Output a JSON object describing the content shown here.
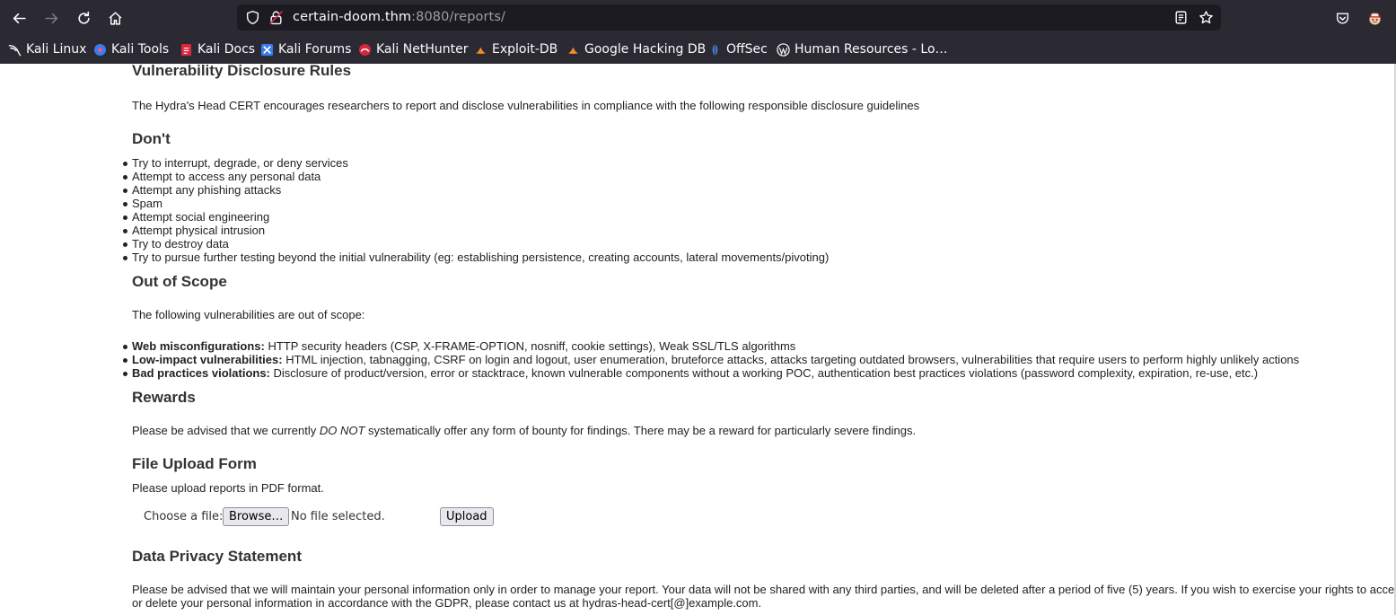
{
  "browser": {
    "url_host": "certain-doom.thm",
    "url_path": ":8080/reports/",
    "bookmarks": [
      {
        "label": "Kali Linux",
        "icon": "kali-dragon-icon"
      },
      {
        "label": "Kali Tools",
        "icon": "kali-tools-icon"
      },
      {
        "label": "Kali Docs",
        "icon": "kali-docs-icon"
      },
      {
        "label": "Kali Forums",
        "icon": "kali-forums-icon"
      },
      {
        "label": "Kali NetHunter",
        "icon": "kali-nethunter-icon"
      },
      {
        "label": "Exploit-DB",
        "icon": "exploit-db-icon"
      },
      {
        "label": "Google Hacking DB",
        "icon": "ghdb-icon"
      },
      {
        "label": "OffSec",
        "icon": "offsec-icon"
      },
      {
        "label": "Human Resources - Lo…",
        "icon": "wordpress-icon"
      }
    ]
  },
  "page": {
    "title": "Vulnerability Disclosure Rules",
    "intro": "The Hydra's Head CERT encourages researchers to report and disclose vulnerabilities in compliance with the following responsible disclosure guidelines",
    "dont": {
      "heading": "Don't",
      "items": [
        "Try to interrupt, degrade, or deny services",
        "Attempt to access any personal data",
        "Attempt any phishing attacks",
        "Spam",
        "Attempt social engineering",
        "Attempt physical intrusion",
        "Try to destroy data",
        "Try to pursue further testing beyond the initial vulnerability (eg: establishing persistence, creating accounts, lateral movements/pivoting)"
      ]
    },
    "scope": {
      "heading": "Out of Scope",
      "intro": "The following vulnerabilities are out of scope:",
      "items": [
        {
          "term": "Web misconfigurations:",
          "desc": " HTTP security headers (CSP, X-FRAME-OPTION, nosniff, cookie settings), Weak SSL/TLS algorithms"
        },
        {
          "term": "Low-impact vulnerabilities:",
          "desc": " HTML injection, tabnagging, CSRF on login and logout, user enumeration, bruteforce attacks, attacks targeting outdated browsers, vulnerabilities that require users to perform highly unlikely actions"
        },
        {
          "term": "Bad practices violations:",
          "desc": " Disclosure of product/version, error or stacktrace, known vulnerable components without a working POC, authentication best practices violations (password complexity, expiration, re-use, etc.)"
        }
      ]
    },
    "rewards": {
      "heading": "Rewards",
      "text_before": "Please be advised that we currently ",
      "text_em": "DO NOT",
      "text_after": " systematically offer any form of bounty for findings. There may be a reward for particularly severe findings."
    },
    "upload": {
      "heading": "File Upload Form",
      "hint": "Please upload reports in PDF format.",
      "choose_label": "Choose a file:",
      "browse_label": "Browse…",
      "status": "No file selected.",
      "upload_label": "Upload"
    },
    "privacy": {
      "heading": "Data Privacy Statement",
      "line1": "Please be advised that we will maintain your personal information only in order to manage your report. Your data will not be shared with any third parties, and will be deleted after a period of five (5) years. If you wish to exercise your rights to access,",
      "line2": "or delete your personal information in accordance with the GDPR, please contact us at hydras-head-cert[@]example.com."
    }
  }
}
